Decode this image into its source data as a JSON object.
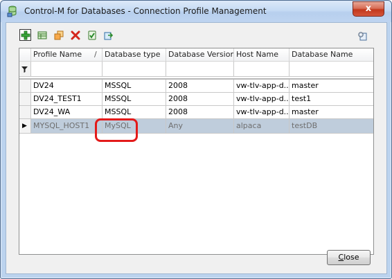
{
  "window": {
    "title": "Control-M for Databases - Connection Profile Management",
    "close_glyph": "x"
  },
  "toolbar": {
    "buttons": [
      {
        "name": "add-profile-icon",
        "icon": "plus-icon"
      },
      {
        "name": "edit-profile-icon",
        "icon": "table-edit-icon"
      },
      {
        "name": "copy-profile-icon",
        "icon": "copy-icon"
      },
      {
        "name": "delete-profile-icon",
        "icon": "red-x-icon"
      },
      {
        "name": "test-profile-icon",
        "icon": "check-icon"
      },
      {
        "name": "export-profile-icon",
        "icon": "export-icon"
      }
    ],
    "right_icon": "settings-icon"
  },
  "grid": {
    "columns": [
      "Profile Name",
      "Database type",
      "Database Version",
      "Host Name",
      "Database Name"
    ],
    "sort_glyph": "/",
    "filter_glyph": "filter-icon",
    "rows": [
      [
        "DV24",
        "MSSQL",
        "2008",
        "vw-tlv-app-d...",
        "master"
      ],
      [
        "DV24_TEST1",
        "MSSQL",
        "2008",
        "vw-tlv-app-d...",
        "test1"
      ],
      [
        "DV24_WA",
        "MSSQL",
        "2008",
        "vw-tlv-app-d...",
        "master"
      ],
      [
        "MYSQL_HOST1",
        "MySQL",
        "Any",
        "alpaca",
        "testDB"
      ]
    ],
    "selected_row_index": 3,
    "current_row_marker": "▶"
  },
  "footer": {
    "close_label_first": "C",
    "close_label_rest": "lose"
  },
  "colors": {
    "selection": "#bfcddc",
    "annotation": "#e31a1a"
  }
}
